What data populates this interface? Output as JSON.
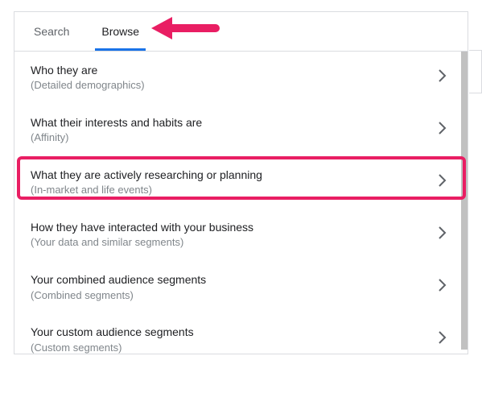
{
  "tabs": {
    "search": "Search",
    "browse": "Browse",
    "active": "browse"
  },
  "categories": [
    {
      "title": "Who they are",
      "subtitle": "(Detailed demographics)"
    },
    {
      "title": "What their interests and habits are",
      "subtitle": "(Affinity)"
    },
    {
      "title": "What they are actively researching or planning",
      "subtitle": "(In-market and life events)"
    },
    {
      "title": "How they have interacted with your business",
      "subtitle": "(Your data and similar segments)"
    },
    {
      "title": "Your combined audience segments",
      "subtitle": "(Combined segments)"
    },
    {
      "title": "Your custom audience segments",
      "subtitle": "(Custom segments)"
    }
  ],
  "annotations": {
    "arrow_points_to": "browse-tab",
    "highlight_index": 2,
    "highlight_color": "#e91e63"
  }
}
